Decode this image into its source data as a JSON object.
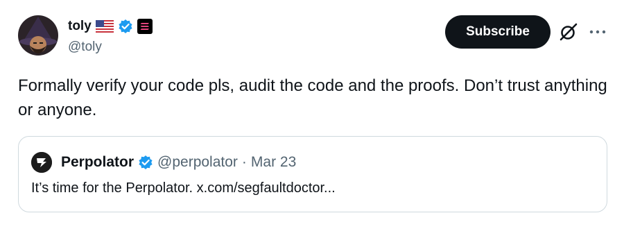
{
  "author": {
    "name": "toly",
    "handle": "@toly"
  },
  "actions": {
    "subscribe_label": "Subscribe"
  },
  "tweet": {
    "text": "Formally verify your code pls, audit the code and the proofs.  Don’t trust anything or anyone."
  },
  "quote": {
    "name": "Perpolator",
    "handle": "@perpolator",
    "separator": "·",
    "date": "Mar 23",
    "text": "It’s time for the Perpolator. x.com/segfaultdoctor..."
  },
  "colors": {
    "text_primary": "#0f1419",
    "text_secondary": "#536471",
    "verified_blue": "#1d9bf0",
    "border": "#cfd9de"
  },
  "icons": {
    "flag": "us-flag-icon",
    "verified": "verified-badge-icon",
    "affiliate": "solana-affiliate-icon",
    "grok": "grok-icon",
    "more": "more-horizontal-icon"
  }
}
